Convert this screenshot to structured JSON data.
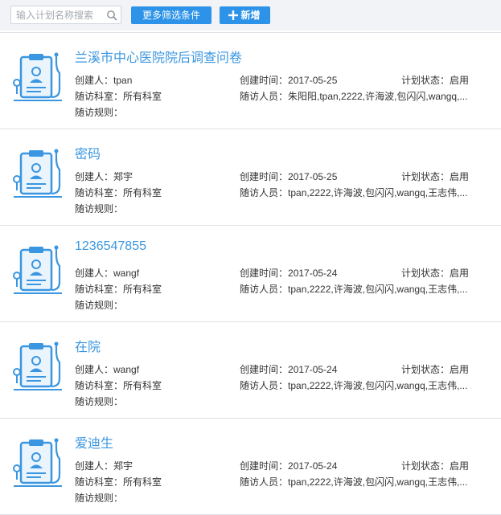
{
  "search": {
    "placeholder": "输入计划名称搜索"
  },
  "toolbar": {
    "more_filters_label": "更多筛选条件",
    "add_label": "新增",
    "accent_color": "#2d93e8"
  },
  "labels": {
    "creator": "创建人：",
    "department": "随访科室：",
    "rule": "随访规则：",
    "created_time": "创建时间：",
    "staff": "随访人员：",
    "status": "计划状态："
  },
  "plans": [
    {
      "title": "兰溪市中心医院院后调查问卷",
      "creator": "tpan",
      "department": "所有科室",
      "rule": "",
      "created_time": "2017-05-25",
      "staff": "朱阳阳,tpan,2222,许海波,包闪闪,wangq,...",
      "status": "启用",
      "icon": "clipboard-stethoscope-icon"
    },
    {
      "title": "密码",
      "creator": "郑宇",
      "department": "所有科室",
      "rule": "",
      "created_time": "2017-05-25",
      "staff": "tpan,2222,许海波,包闪闪,wangq,王志伟,...",
      "status": "启用",
      "icon": "clipboard-stethoscope-icon"
    },
    {
      "title": "1236547855",
      "creator": "wangf",
      "department": "所有科室",
      "rule": "",
      "created_time": "2017-05-24",
      "staff": "tpan,2222,许海波,包闪闪,wangq,王志伟,...",
      "status": "启用",
      "icon": "clipboard-stethoscope-icon"
    },
    {
      "title": "在院",
      "creator": "wangf",
      "department": "所有科室",
      "rule": "",
      "created_time": "2017-05-24",
      "staff": "tpan,2222,许海波,包闪闪,wangq,王志伟,...",
      "status": "启用",
      "icon": "clipboard-stethoscope-icon"
    },
    {
      "title": "爱迪生",
      "creator": "郑宇",
      "department": "所有科室",
      "rule": "",
      "created_time": "2017-05-24",
      "staff": "tpan,2222,许海波,包闪闪,wangq,王志伟,...",
      "status": "启用",
      "icon": "clipboard-stethoscope-icon"
    }
  ]
}
